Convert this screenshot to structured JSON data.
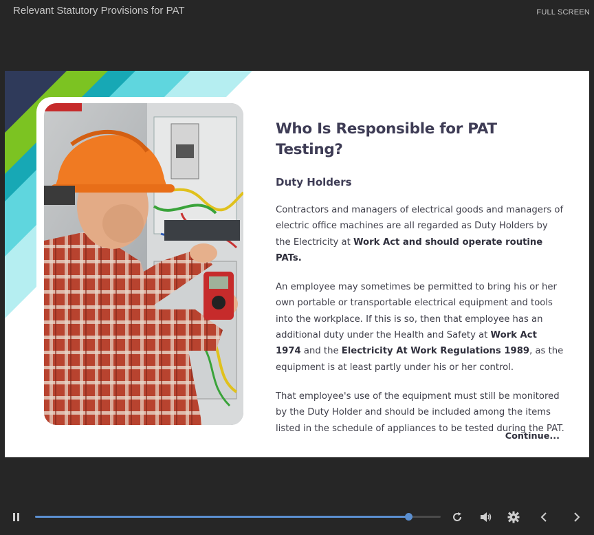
{
  "header": {
    "title": "Relevant Statutory Provisions for PAT",
    "fullscreen_label": "FULL SCREEN"
  },
  "slide": {
    "heading": "Who Is Responsible for PAT Testing?",
    "subheading": "Duty Holders",
    "p1": {
      "text": "Contractors and managers of electrical goods and managers of electric office machines are all regarded as Duty Holders by the Electricity at ",
      "bold": "Work Act and should operate routine PATs."
    },
    "p2": {
      "text1": "An employee may sometimes be permitted to bring his or her own portable or transportable electrical equipment and tools into the workplace. If this is so, then that employee has an additional duty under the Health and Safety at ",
      "bold1": "Work Act 1974",
      "text2": " and the ",
      "bold2": "Electricity At Work Regulations 1989",
      "text3": ", as the equipment is at least partly under his or her control."
    },
    "p3": {
      "text": "That employee's use of the equipment must still be monitored by the Duty Holder and should be included among the items listed in the schedule of appliances to be tested during the PAT."
    },
    "continue_label": "Continue..."
  },
  "player": {
    "progress": 0.92,
    "icons": [
      "pause-icon",
      "replay-icon",
      "volume-icon",
      "settings-icon",
      "prev-icon",
      "next-icon"
    ],
    "accent_color": "#5b8fd0"
  },
  "colors": {
    "background": "#262626",
    "slide": "#ffffff",
    "deco_navy": "#2f3a5a",
    "deco_green": "#7cc322",
    "deco_teal": "#17a8b5",
    "deco_aqua": "#5fd6de",
    "deco_pale": "#b5eef1"
  }
}
